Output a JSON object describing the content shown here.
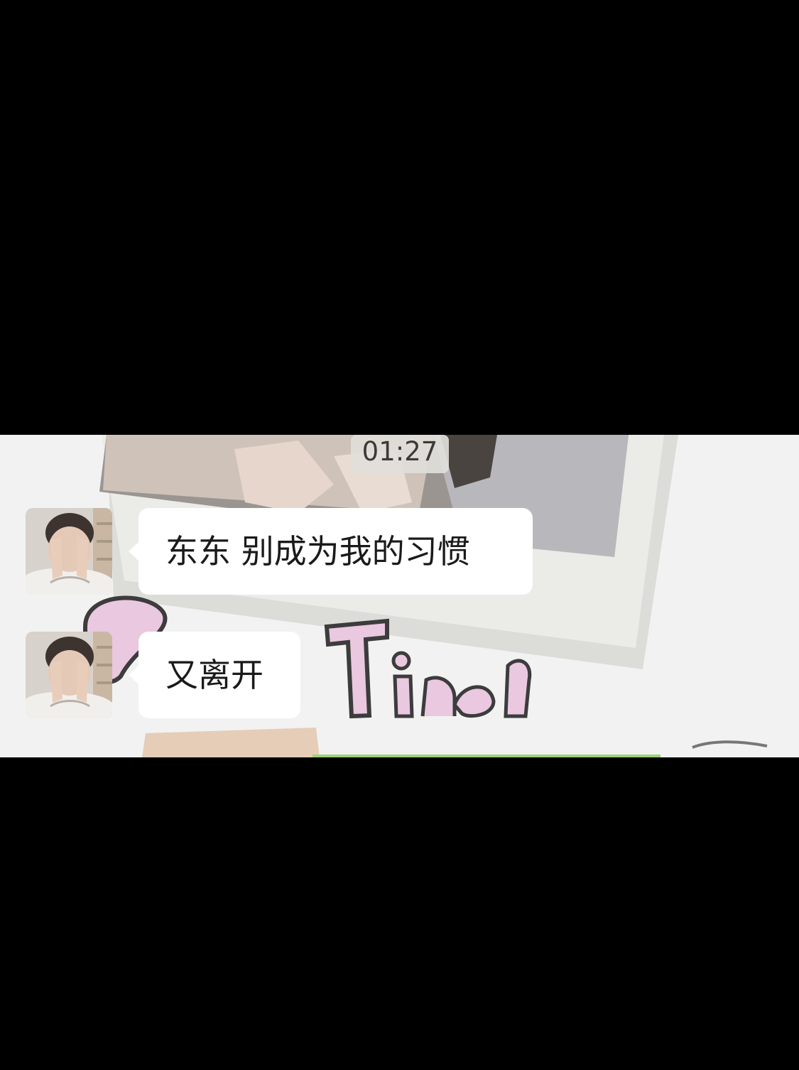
{
  "chat": {
    "timestamp": "01:27",
    "messages": [
      {
        "sender": "other",
        "avatar_icon": "face-covered-avatar",
        "text": "东东 别成为我的习惯"
      },
      {
        "sender": "other",
        "avatar_icon": "face-covered-avatar",
        "text": "又离开"
      }
    ]
  },
  "colors": {
    "chat_background": "#f2f2f2",
    "bubble_incoming": "#ffffff",
    "timestamp_bg": "#e1deda",
    "letterbox": "#000000"
  }
}
